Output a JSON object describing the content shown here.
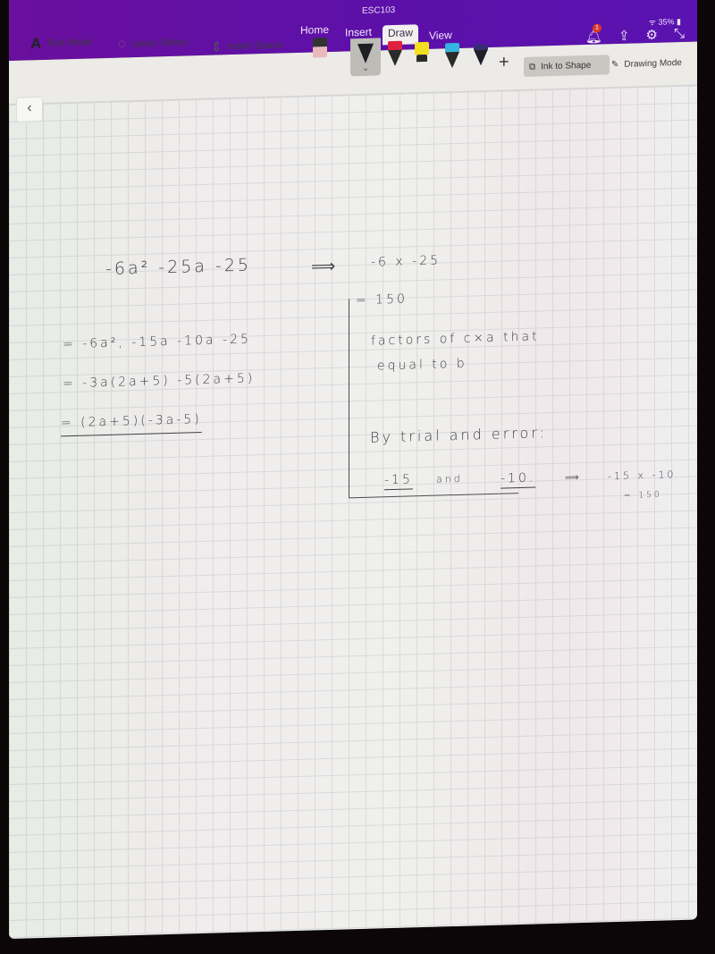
{
  "app": {
    "doc_title": "ESC103",
    "tabs": [
      {
        "label": "Home",
        "active": false
      },
      {
        "label": "Insert",
        "active": false
      },
      {
        "label": "Draw",
        "active": true
      },
      {
        "label": "View",
        "active": false
      }
    ],
    "status": {
      "battery": "35%"
    },
    "notification_count": "1",
    "accent_color": "#5d10a8"
  },
  "toolbar": {
    "text_mode": "Text Mode",
    "lasso_select": "Lasso Select",
    "insert_space": "Insert Space",
    "add_pen": "+",
    "ink_to_shape": "Ink to Shape",
    "drawing_mode": "Drawing Mode",
    "pens": [
      {
        "name": "eraser",
        "color": "#e8b9bb"
      },
      {
        "name": "black-pen",
        "color": "#1f1f22",
        "selected": true
      },
      {
        "name": "red-pen",
        "color": "#e02040"
      },
      {
        "name": "yellow-highlighter",
        "color": "#f2e020"
      },
      {
        "name": "blue-pen",
        "color": "#33b5e0"
      },
      {
        "name": "purple-pen",
        "color": "#3a2a7a"
      }
    ]
  },
  "nav": {
    "back_icon": "‹"
  },
  "notes": {
    "problem": "-6a² -25a -25",
    "arrow1": "⟹",
    "product": "-6 x -25",
    "product_result": "= 150",
    "step1": "= -6a², -15a -10a -25",
    "step2": "= -3a(2a+5) -5(2a+5)",
    "step3": "= (2a+5)(-3a-5)",
    "explain_line1": "factors of  c×a  that",
    "explain_line2": "equal  to   b",
    "trial": "By trial and error:",
    "factor1": "-15",
    "and": "and",
    "factor2": "-10.",
    "arrow2": "⟹",
    "check": "-15 x -10",
    "check_result": "= 150"
  }
}
